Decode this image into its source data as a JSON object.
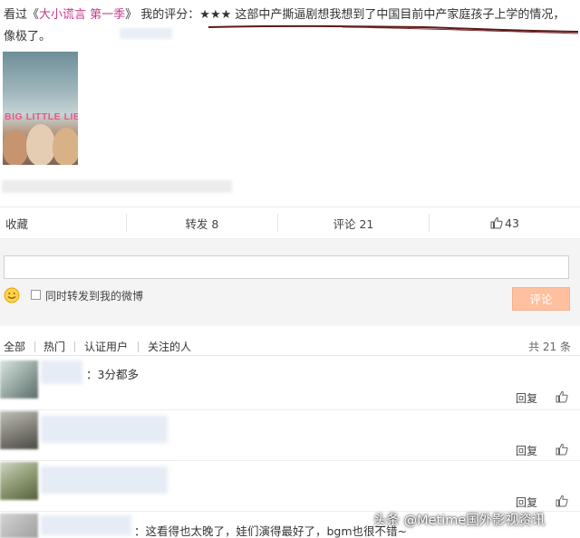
{
  "post": {
    "prefix": "看过《",
    "show_title": "大小谎言 第一季",
    "middle": "》 我的评分：",
    "stars": "★★★",
    "body": " 这部中产撕逼剧想我想到了中国目前中产家庭孩子上学的情况，像极了。",
    "poster_title": "BIG LITTLE LIES"
  },
  "actions": {
    "favorite": "收藏",
    "repost": "转发 8",
    "comment": "评论 21",
    "like_count": "43"
  },
  "composer": {
    "input_value": "",
    "repost_label": "同时转发到我的微博",
    "submit_label": "评论"
  },
  "filters": {
    "tabs": [
      "全部",
      "热门",
      "认证用户",
      "关注的人"
    ],
    "total": "共 21 条"
  },
  "comments": [
    {
      "text": "：3分都多",
      "reply": "回复"
    },
    {
      "text": "",
      "reply": "回复"
    },
    {
      "text": "",
      "reply": "回复"
    },
    {
      "text": "：这看得也太晚了，娃们演得最好了，bgm也很不错~",
      "reply": ""
    }
  ],
  "watermark": {
    "prefix": "头条",
    "handle": "@Metime国外影视资讯"
  },
  "colors": {
    "link": "#c23b8b",
    "button": "#ffc09f",
    "underline": "#5a1a1a"
  }
}
